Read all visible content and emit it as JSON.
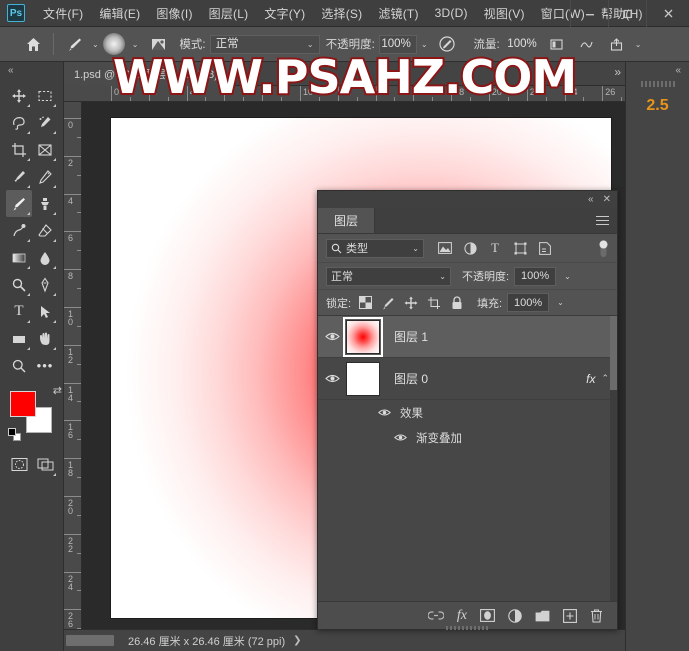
{
  "app": {
    "logo": "Ps",
    "watermark": "WWW.PSAHZ.COM"
  },
  "menubar": {
    "items": [
      {
        "label": "文件(F)",
        "name": "menu-file"
      },
      {
        "label": "编辑(E)",
        "name": "menu-edit"
      },
      {
        "label": "图像(I)",
        "name": "menu-image"
      },
      {
        "label": "图层(L)",
        "name": "menu-layer"
      },
      {
        "label": "文字(Y)",
        "name": "menu-type"
      },
      {
        "label": "选择(S)",
        "name": "menu-select"
      },
      {
        "label": "滤镜(T)",
        "name": "menu-filter"
      },
      {
        "label": "3D(D)",
        "name": "menu-3d"
      },
      {
        "label": "视图(V)",
        "name": "menu-view"
      },
      {
        "label": "窗口(W)",
        "name": "menu-window"
      },
      {
        "label": "帮助(H)",
        "name": "menu-help"
      }
    ],
    "window_controls": {
      "minimize": "—",
      "maximize": "▢",
      "close": "✕"
    }
  },
  "options_bar": {
    "home_icon": "home-icon",
    "tool_icon": "brush-tool-icon",
    "mode_label": "模式:",
    "mode_value": "正常",
    "opacity_label": "不透明度:",
    "opacity_value": "100%",
    "airbrush_icon": "airbrush-icon",
    "flow_label": "流量:",
    "flow_value": "100%",
    "tablet_pressure_icon": "tablet-pressure-icon",
    "smoothing_icon": "smoothing-icon",
    "upload_icon": "share-upload-icon"
  },
  "tab_bar": {
    "doc_title": "1.psd @ 50%(图层 1, RGB/8) *",
    "expand_icon": "»"
  },
  "toolbar": {
    "collapse_icon": "«",
    "tools": [
      {
        "name": "move-tool",
        "glyph": "✥",
        "active": false
      },
      {
        "name": "marquee-tool",
        "glyph": "▭",
        "active": false
      },
      {
        "name": "lasso-tool",
        "glyph": "𝒮",
        "active": false
      },
      {
        "name": "quick-select-tool",
        "glyph": "❧",
        "active": false
      },
      {
        "name": "crop-tool",
        "glyph": "⌗",
        "active": false
      },
      {
        "name": "frame-tool",
        "glyph": "⊠",
        "active": false
      },
      {
        "name": "eyedropper-tool",
        "glyph": "⌁",
        "active": false
      },
      {
        "name": "healing-brush-tool",
        "glyph": "✎",
        "active": false
      },
      {
        "name": "brush-tool",
        "glyph": "🖌",
        "active": true
      },
      {
        "name": "clone-stamp-tool",
        "glyph": "♜",
        "active": false
      },
      {
        "name": "history-brush-tool",
        "glyph": "❥",
        "active": false
      },
      {
        "name": "eraser-tool",
        "glyph": "◺",
        "active": false
      },
      {
        "name": "gradient-tool",
        "glyph": "▰",
        "active": false
      },
      {
        "name": "blur-tool",
        "glyph": "💧",
        "active": false
      },
      {
        "name": "dodge-tool",
        "glyph": "🔍",
        "active": false
      },
      {
        "name": "pen-tool",
        "glyph": "✒",
        "active": false
      },
      {
        "name": "type-tool",
        "glyph": "T",
        "active": false
      },
      {
        "name": "path-select-tool",
        "glyph": "➤",
        "active": false
      },
      {
        "name": "rectangle-tool",
        "glyph": "▭",
        "active": false
      },
      {
        "name": "hand-tool",
        "glyph": "✋",
        "active": false
      },
      {
        "name": "zoom-tool",
        "glyph": "🔎",
        "active": false
      },
      {
        "name": "more-tools",
        "glyph": "•••",
        "active": false
      }
    ],
    "foreground_color": "#ff0000",
    "background_color": "#ffffff",
    "swap_icon": "⇄",
    "quickmask_icon": "quick-mask-icon",
    "screenmode_icon": "screen-mode-icon"
  },
  "rulers": {
    "unit": "厘米",
    "h_labels": [
      "0",
      "2",
      "4",
      "6",
      "8",
      "10",
      "12",
      "14",
      "16",
      "18",
      "20",
      "22",
      "24",
      "26"
    ],
    "v_labels": [
      "0",
      "2",
      "4",
      "6",
      "8",
      "10",
      "12",
      "14",
      "16",
      "18",
      "20",
      "22",
      "24",
      "26"
    ]
  },
  "canvas": {
    "document_name": "1.psd",
    "gradient_center_color": "#ff0a0a",
    "gradient_edge_color": "#ffffff"
  },
  "status_bar": {
    "text": "26.46 厘米 x 26.46 厘米 (72 ppi)",
    "arrow": "❯"
  },
  "right_dock": {
    "collapse_icon": "«",
    "badge": "2.5"
  },
  "layers_panel": {
    "collapse_icon": "«",
    "close_icon": "✕",
    "tab_label": "图层",
    "menu_icon": "☰",
    "filter": {
      "search_icon": "search-icon",
      "kind_label": "类型",
      "caret": "⌄",
      "icons": [
        {
          "name": "filter-pixel-icon",
          "glyph": "🖼"
        },
        {
          "name": "filter-adjustment-icon",
          "glyph": "◑"
        },
        {
          "name": "filter-type-icon",
          "glyph": "T"
        },
        {
          "name": "filter-shape-icon",
          "glyph": "⬚"
        },
        {
          "name": "filter-smartobject-icon",
          "glyph": "🗋"
        }
      ],
      "toggle_icon": "filter-toggle-icon"
    },
    "blend_mode_label": "正常",
    "opacity_label": "不透明度:",
    "opacity_value": "100%",
    "lock_label": "锁定:",
    "lock_icons": [
      {
        "name": "lock-transparent-pixels-icon",
        "glyph": "▦"
      },
      {
        "name": "lock-image-pixels-icon",
        "glyph": "🖌"
      },
      {
        "name": "lock-position-icon",
        "glyph": "✥"
      },
      {
        "name": "lock-artboard-nesting-icon",
        "glyph": "⌗"
      },
      {
        "name": "lock-all-icon",
        "glyph": "🔒"
      }
    ],
    "fill_label": "填充:",
    "fill_value": "100%",
    "layers": [
      {
        "name": "图层 1",
        "visible": true,
        "selected": true,
        "thumb": "red-gradient",
        "has_fx": false,
        "effects": []
      },
      {
        "name": "图层 0",
        "visible": true,
        "selected": false,
        "thumb": "white",
        "has_fx": true,
        "fx_label": "fx",
        "fx_chevron": "⌃",
        "effects": [
          {
            "label": "效果",
            "visible": true,
            "indent": 1
          },
          {
            "label": "渐变叠加",
            "visible": true,
            "indent": 2
          }
        ]
      }
    ],
    "footer_icons": [
      {
        "name": "link-layers-icon",
        "glyph": "🔗"
      },
      {
        "name": "layer-style-fx-icon",
        "glyph": "fx"
      },
      {
        "name": "add-layer-mask-icon",
        "glyph": "▣"
      },
      {
        "name": "new-adjustment-layer-icon",
        "glyph": "◑"
      },
      {
        "name": "new-group-icon",
        "glyph": "🗀"
      },
      {
        "name": "new-layer-icon",
        "glyph": "⊞"
      },
      {
        "name": "delete-layer-icon",
        "glyph": "🗑"
      }
    ]
  }
}
